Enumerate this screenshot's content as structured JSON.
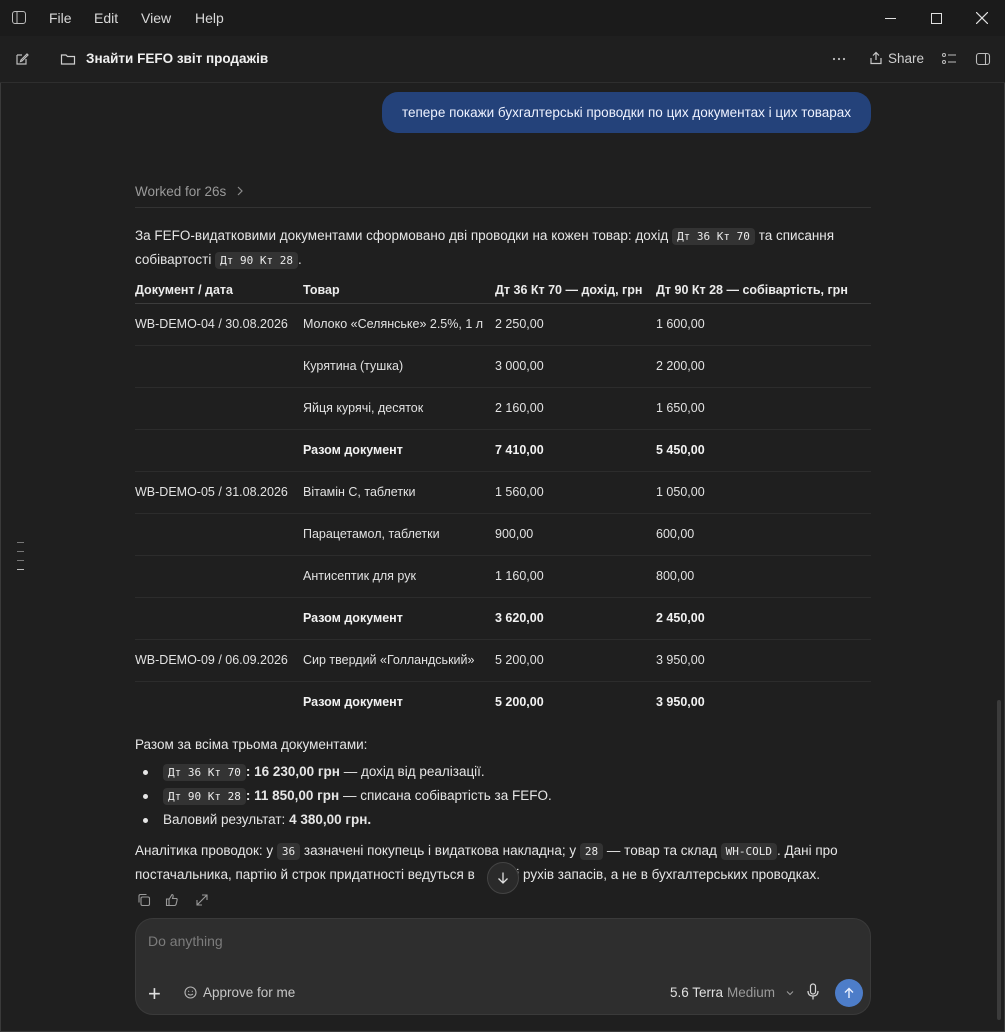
{
  "menu": {
    "items": [
      "File",
      "Edit",
      "View",
      "Help"
    ]
  },
  "header": {
    "title": "Знайти FEFO звіт продажів",
    "share_label": "Share"
  },
  "user_message": "тепере покажи бухгалтерські проводки по цих документах і цих товарах",
  "worked": "Worked for 26s",
  "intro": {
    "text1": "За FEFO-видатковими документами сформовано дві проводки на кожен товар: дохід",
    "code1": "Дт 36 Кт 70",
    "text2": "та списання собівартості",
    "code2": "Дт 90 Кт 28",
    "text3": "."
  },
  "table": {
    "headers": [
      "Документ / дата",
      "Товар",
      "Дт 36 Кт 70 — дохід, грн",
      "Дт 90 Кт 28 — собівартість, грн"
    ],
    "rows": [
      {
        "doc": "WB-DEMO-04 / 30.08.2026",
        "item": "Молоко «Селянське» 2.5%, 1 л",
        "income": "2 250,00",
        "cost": "1 600,00"
      },
      {
        "doc": "",
        "item": "Курятина (тушка)",
        "income": "3 000,00",
        "cost": "2 200,00"
      },
      {
        "doc": "",
        "item": "Яйця курячі, десяток",
        "income": "2 160,00",
        "cost": "1 650,00"
      },
      {
        "doc": "",
        "item": "Разом документ",
        "income": "7 410,00",
        "cost": "5 450,00",
        "total": true
      },
      {
        "doc": "WB-DEMO-05 / 31.08.2026",
        "item": "Вітамін С, таблетки",
        "income": "1 560,00",
        "cost": "1 050,00"
      },
      {
        "doc": "",
        "item": "Парацетамол, таблетки",
        "income": "900,00",
        "cost": "600,00"
      },
      {
        "doc": "",
        "item": "Антисептик для рук",
        "income": "1 160,00",
        "cost": "800,00"
      },
      {
        "doc": "",
        "item": "Разом документ",
        "income": "3 620,00",
        "cost": "2 450,00",
        "total": true
      },
      {
        "doc": "WB-DEMO-09 / 06.09.2026",
        "item": "Сир твердий «Голландський»",
        "income": "5 200,00",
        "cost": "3 950,00"
      },
      {
        "doc": "",
        "item": "Разом документ",
        "income": "5 200,00",
        "cost": "3 950,00",
        "total": true
      }
    ]
  },
  "summary": {
    "heading": "Разом за всіма трьома документами:",
    "bullets": [
      {
        "code": "Дт 36 Кт 70",
        "bold": ": 16 230,00 грн",
        "rest": " — дохід від реалізації."
      },
      {
        "code": "Дт 90 Кт 28",
        "bold": ": 11 850,00 грн",
        "rest": " — списана собівартість за FEFO."
      },
      {
        "code": "",
        "lead": "Валовий результат: ",
        "bold": "4 380,00 грн.",
        "rest": ""
      }
    ]
  },
  "analytics": {
    "t1": "Аналітика проводок: у",
    "c1": "36",
    "t2": "зазначені покупець і видаткова накладна; у",
    "c2": "28",
    "t3": "— товар та склад",
    "c3": "WH-COLD",
    "t4": ". Дані про постачальника, партію й строк придатності ведуться в",
    "t5": "трі рухів запасів, а не в бухгалтерських проводках."
  },
  "composer": {
    "placeholder": "Do anything",
    "approve_label": "Approve for me",
    "model": "5.6 Terra",
    "effort": "Medium"
  },
  "icons": {
    "sidebar": "sidebar-toggle-icon",
    "edit": "compose-icon",
    "folder": "folder-icon",
    "more": "more-horizontal-icon",
    "share": "share-icon",
    "panel": "panel-icon"
  }
}
